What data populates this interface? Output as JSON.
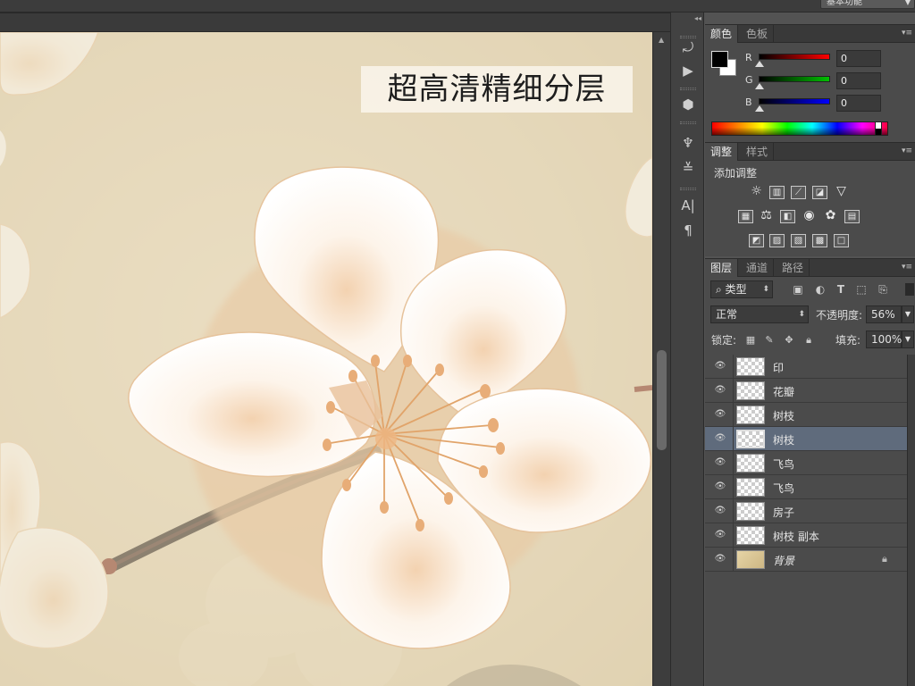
{
  "top_bar": {
    "workspace_label": "基本功能"
  },
  "canvas": {
    "overlay_title": "超高清精细分层"
  },
  "color_panel": {
    "tabs": [
      "颜色",
      "色板"
    ],
    "channels": [
      {
        "label": "R",
        "value": "0",
        "color": "#ff0000"
      },
      {
        "label": "G",
        "value": "0",
        "color": "#00c000"
      },
      {
        "label": "B",
        "value": "0",
        "color": "#0000ff"
      }
    ],
    "foreground": "#000000",
    "background": "#ffffff"
  },
  "adjust_panel": {
    "tabs": [
      "调整",
      "样式"
    ],
    "title": "添加调整",
    "icons": [
      [
        "brightness-icon",
        "levels-icon",
        "curves-icon",
        "exposure-icon",
        "vibrance-icon"
      ],
      [
        "hue-saturation-icon",
        "color-balance-icon",
        "black-white-icon",
        "photo-filter-icon",
        "channel-mixer-icon",
        "color-lookup-icon"
      ],
      [
        "invert-icon",
        "posterize-icon",
        "threshold-icon",
        "gradient-map-icon",
        "selective-color-icon"
      ]
    ]
  },
  "layers_panel": {
    "tabs": [
      "图层",
      "通道",
      "路径"
    ],
    "filter_kind": "类型",
    "blend_mode": "正常",
    "opacity_label": "不透明度:",
    "opacity_value": "56%",
    "lock_label": "锁定:",
    "fill_label": "填充:",
    "fill_value": "100%",
    "layers": [
      {
        "name": "印",
        "selected": false,
        "locked": false
      },
      {
        "name": "花瓣",
        "selected": false,
        "locked": false
      },
      {
        "name": "树枝",
        "selected": false,
        "locked": false
      },
      {
        "name": "树枝",
        "selected": true,
        "locked": false
      },
      {
        "name": "飞鸟",
        "selected": false,
        "locked": false
      },
      {
        "name": "飞鸟",
        "selected": false,
        "locked": false
      },
      {
        "name": "房子",
        "selected": false,
        "locked": false
      },
      {
        "name": "树枝 副本",
        "selected": false,
        "locked": false
      },
      {
        "name": "背景",
        "selected": false,
        "locked": true
      }
    ]
  }
}
